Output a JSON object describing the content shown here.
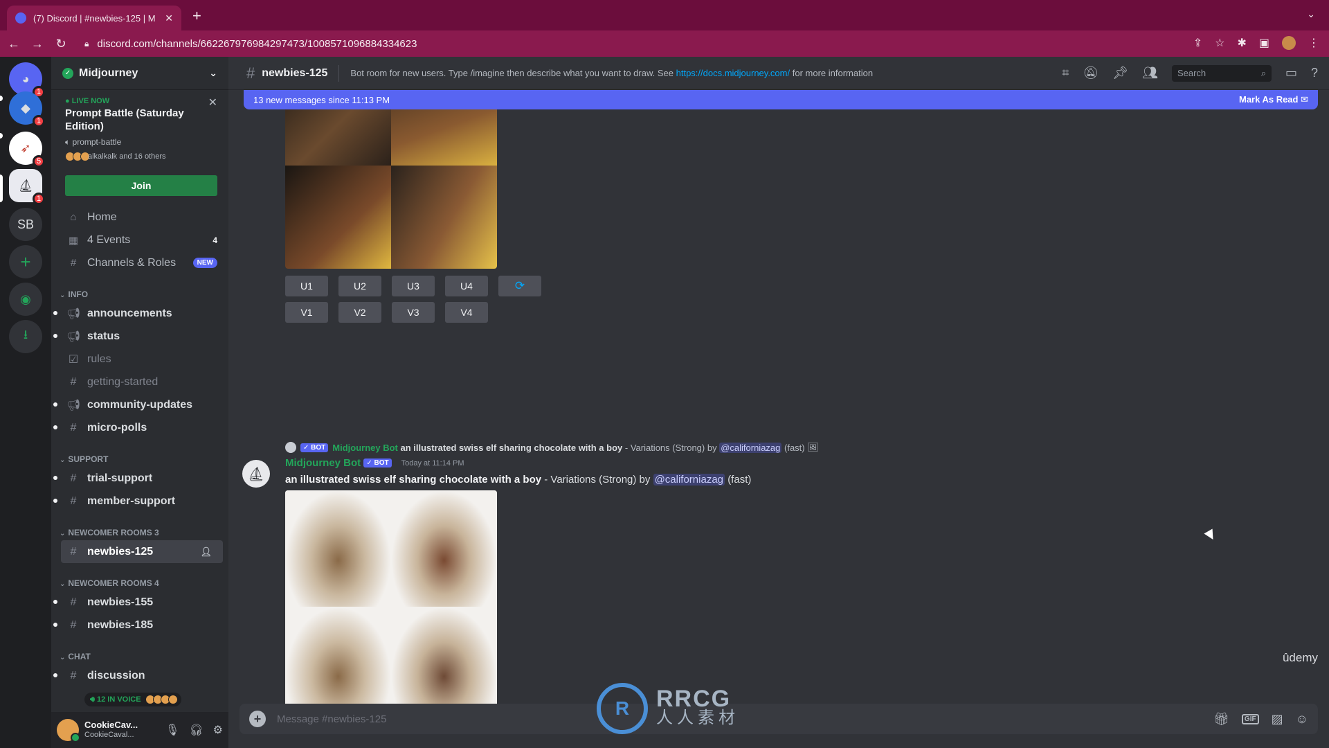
{
  "browser": {
    "tab_title": "(7) Discord | #newbies-125 | M",
    "url": "discord.com/channels/662267976984297473/1008571096884334623"
  },
  "colors": {
    "accent": "#5865f2",
    "online": "#23a55a",
    "browser_frame": "#8a1a4e"
  },
  "rail": {
    "items": [
      {
        "label": "discord-home",
        "badge": "1"
      },
      {
        "label": "",
        "badge": "1"
      },
      {
        "label": "",
        "badge": "5"
      },
      {
        "label": "",
        "badge": "1"
      },
      {
        "label": "SB",
        "badge": ""
      },
      {
        "label": "+",
        "badge": ""
      },
      {
        "label": "explore",
        "badge": ""
      },
      {
        "label": "download",
        "badge": ""
      }
    ]
  },
  "server": {
    "name": "Midjourney"
  },
  "live": {
    "tag": "LIVE NOW",
    "title": "Prompt Battle (Saturday Edition)",
    "channel": "prompt-battle",
    "users": "alkalkalk and 16 others",
    "join": "Join"
  },
  "nav": {
    "home": "Home",
    "events": "4 Events",
    "events_count": "4",
    "channels_roles": "Channels & Roles",
    "new_badge": "NEW"
  },
  "categories": {
    "info": "INFO",
    "support": "SUPPORT",
    "newcomer3": "NEWCOMER ROOMS 3",
    "newcomer4": "NEWCOMER ROOMS 4",
    "chat": "CHAT"
  },
  "channels": {
    "announcements": "announcements",
    "status": "status",
    "rules": "rules",
    "getting_started": "getting-started",
    "community_updates": "community-updates",
    "micro_polls": "micro-polls",
    "trial_support": "trial-support",
    "member_support": "member-support",
    "newbies_125": "newbies-125",
    "newbies_155": "newbies-155",
    "newbies_185": "newbies-185",
    "discussion": "discussion"
  },
  "voice": {
    "label": "12 IN VOICE"
  },
  "user": {
    "name": "CookieCav...",
    "tag": "CookieCaval..."
  },
  "header": {
    "channel": "newbies-125",
    "topic_prefix": "Bot room for new users. Type /imagine then describe what you want to draw. See",
    "topic_link": "https://docs.midjourney.com/",
    "topic_suffix": "for more information",
    "search_placeholder": "Search"
  },
  "new_messages": {
    "text": "13 new messages since 11:13 PM",
    "mark": "Mark As Read"
  },
  "upscale_buttons": [
    "U1",
    "U2",
    "U3",
    "U4"
  ],
  "variation_buttons": [
    "V1",
    "V2",
    "V3",
    "V4"
  ],
  "message": {
    "reply_bot_tag": "✓ BOT",
    "reply_author": "Midjourney Bot",
    "reply_prompt": "an illustrated swiss elf sharing chocolate with a boy",
    "reply_suffix": "- Variations (Strong) by",
    "reply_mention": "@californiazag",
    "reply_speed": "(fast)",
    "author": "Midjourney Bot",
    "bot_tag": "✓ BOT",
    "time": "Today at 11:14 PM",
    "prompt": "an illustrated swiss elf sharing chocolate with a boy",
    "suffix": "- Variations (Strong) by",
    "mention": "@californiazag",
    "speed": "(fast)"
  },
  "composer": {
    "placeholder": "Message #newbies-125"
  },
  "overlay": {
    "udemy": "ûdemy",
    "wm_main": "RRCG",
    "wm_sub": "人人素材"
  }
}
